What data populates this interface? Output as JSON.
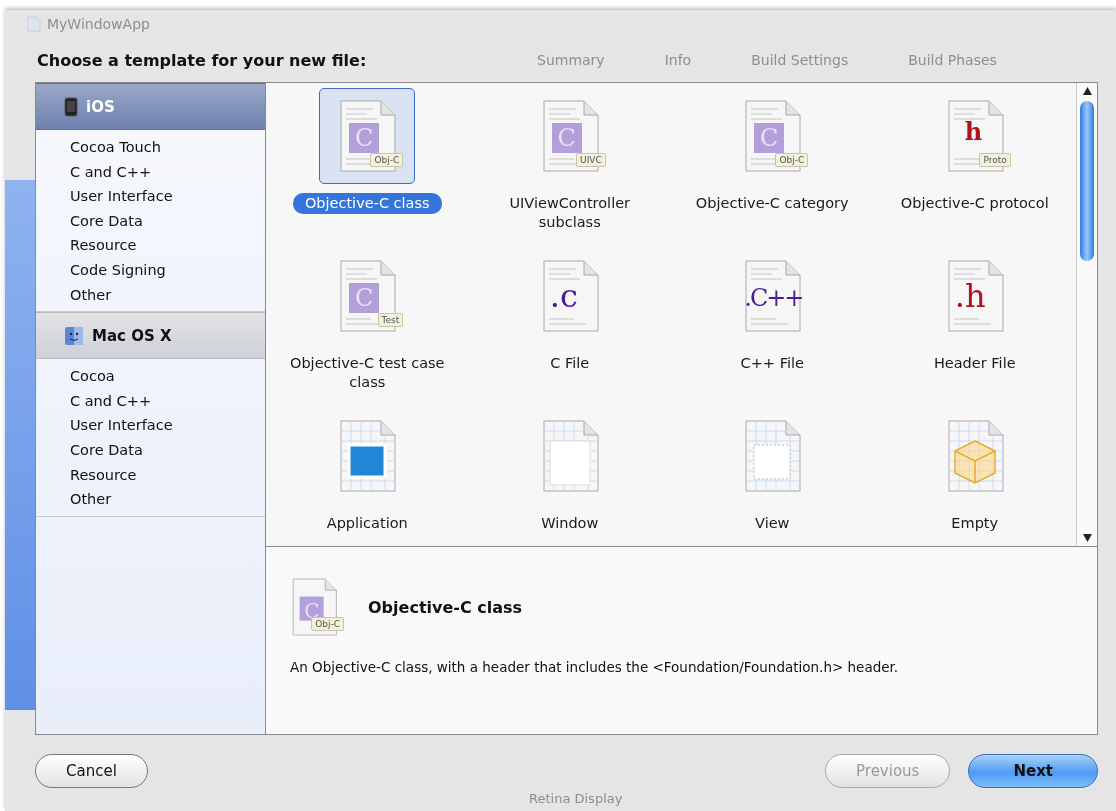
{
  "window": {
    "title": "MyWindowApp"
  },
  "background_tabs": [
    "Summary",
    "Info",
    "Build Settings",
    "Build Phases"
  ],
  "background_caption": "Retina Display",
  "heading": "Choose a template for your new file:",
  "sidebar": [
    {
      "label": "iOS",
      "selected": true,
      "items": [
        "Cocoa Touch",
        "C and C++",
        "User Interface",
        "Core Data",
        "Resource",
        "Code Signing",
        "Other"
      ]
    },
    {
      "label": "Mac OS X",
      "selected": false,
      "items": [
        "Cocoa",
        "C and C++",
        "User Interface",
        "Core Data",
        "Resource",
        "Other"
      ]
    }
  ],
  "templates": [
    {
      "label": "Objective-C class",
      "kind": "objc",
      "glyph": "C",
      "tag": "Obj-C",
      "selected": true
    },
    {
      "label": "UIViewController subclass",
      "kind": "objc",
      "glyph": "C",
      "tag": "UIVC",
      "selected": false
    },
    {
      "label": "Objective-C category",
      "kind": "objc",
      "glyph": "C",
      "tag": "Obj-C",
      "selected": false
    },
    {
      "label": "Objective-C protocol",
      "kind": "proto",
      "glyph": "h",
      "tag": "Proto",
      "selected": false
    },
    {
      "label": "Objective-C test case class",
      "kind": "objc",
      "glyph": "C",
      "tag": "Test",
      "selected": false
    },
    {
      "label": "C File",
      "kind": "c",
      "glyph": ".c",
      "selected": false
    },
    {
      "label": "C++ File",
      "kind": "cpp",
      "glyph": ".C++",
      "selected": false
    },
    {
      "label": "Header File",
      "kind": "h",
      "glyph": ".h",
      "selected": false
    },
    {
      "label": "Application",
      "kind": "app",
      "selected": false
    },
    {
      "label": "Window",
      "kind": "window",
      "selected": false
    },
    {
      "label": "View",
      "kind": "view",
      "selected": false
    },
    {
      "label": "Empty",
      "kind": "empty",
      "selected": false
    }
  ],
  "description": {
    "kind": "objc",
    "glyph": "C",
    "tag": "Obj-C",
    "title": "Objective-C class",
    "text": "An Objective-C class, with a header that includes the <Foundation/Foundation.h> header."
  },
  "buttons": [
    {
      "label": "Cancel",
      "kind": "normal",
      "disabled": false
    },
    {
      "label": "Previous",
      "kind": "normal",
      "disabled": true
    },
    {
      "label": "Next",
      "kind": "default",
      "disabled": false
    }
  ]
}
